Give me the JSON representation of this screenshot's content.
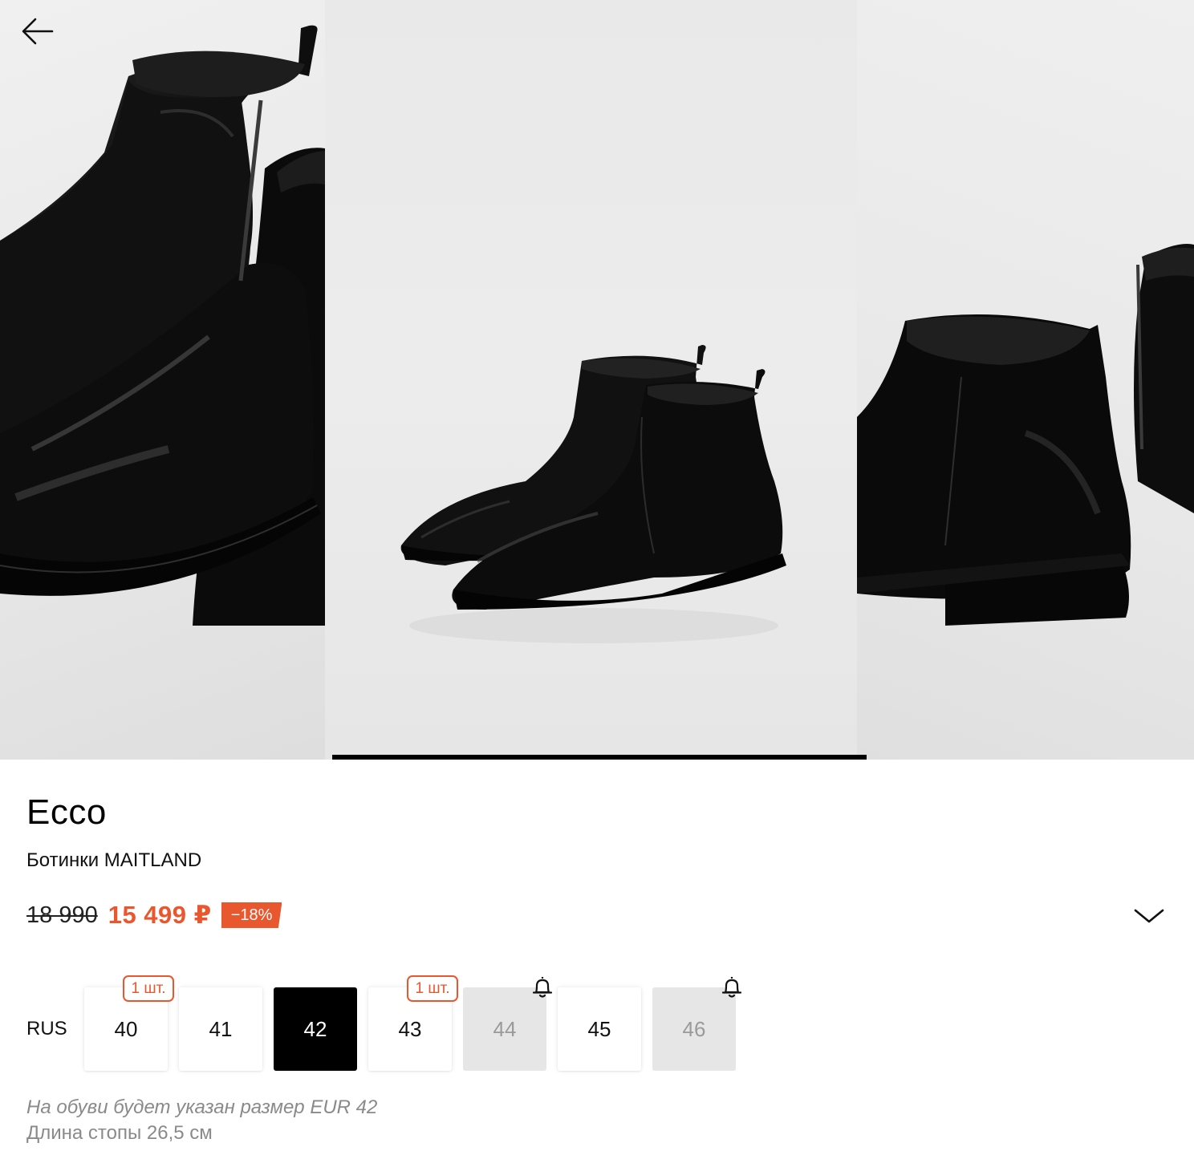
{
  "product": {
    "brand": "Ecco",
    "name": "Ботинки MAITLAND"
  },
  "price": {
    "old": "18 990",
    "current": "15 499 ₽",
    "discount": "−18%"
  },
  "colors": {
    "accent": "#e8572e",
    "selected_size_bg": "#000000",
    "unavailable_size_bg": "#e6e6e6"
  },
  "gallery": {
    "slides": 3,
    "active_slide": 2
  },
  "sizes": {
    "system": "RUS",
    "items": [
      {
        "value": "40",
        "state": "available",
        "badge": "1 шт."
      },
      {
        "value": "41",
        "state": "available"
      },
      {
        "value": "42",
        "state": "selected"
      },
      {
        "value": "43",
        "state": "available",
        "badge": "1 шт."
      },
      {
        "value": "44",
        "state": "unavailable",
        "icon": "bell-icon"
      },
      {
        "value": "45",
        "state": "available"
      },
      {
        "value": "46",
        "state": "unavailable",
        "icon": "bell-icon"
      }
    ]
  },
  "size_info": {
    "note": "На обуви будет указан размер EUR 42",
    "foot_length": "Длина стопы 26,5 см"
  },
  "icons": [
    "back-arrow-icon",
    "chevron-down-icon",
    "bell-icon"
  ]
}
